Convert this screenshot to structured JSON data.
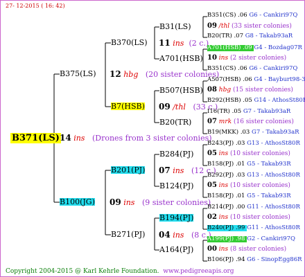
{
  "header": {
    "date": "27- 12-2015 ( 16: 42)"
  },
  "footer": {
    "copyright": "Copyright 2004-2015 @ Karl Kehrle Foundation.",
    "site": "www.pedigreeapis.org"
  },
  "root": {
    "label": "B371(LS)",
    "num": "14",
    "mark": "ins",
    "note": "(Drones from 3 sister colonies)"
  },
  "g1": [
    {
      "label": "B375(LS)",
      "num": "12",
      "mark": "hbg",
      "note": "(20 sister colonies)"
    },
    {
      "label": "B100(JG)",
      "num": "09",
      "mark": "ins",
      "note": "(9 sister colonies)"
    }
  ],
  "g2": [
    {
      "label": "B370(LS)",
      "num": "11",
      "mark": "ins",
      "note": "(2 c.)"
    },
    {
      "label": "B7(HSB)",
      "num": "09",
      "mark": "/thl",
      "note": "(33 c.)"
    },
    {
      "label": "B201(PJ)",
      "num": "07",
      "mark": "ins",
      "note": "(12 c.)"
    },
    {
      "label": "B271(PJ)",
      "num": "04",
      "mark": "ins",
      "note": "(8 c.)"
    }
  ],
  "g3": [
    {
      "label": "B31(LS)",
      "num": "09",
      "mark": "/thl",
      "note": "(33 sister colonies)"
    },
    {
      "label": "A701(HSB)",
      "num": "10",
      "mark": "ins",
      "note": "(2 sister colonies)"
    },
    {
      "label": "B507(HSB)",
      "num": "08",
      "mark": "hbg",
      "note": "(15 sister colonies)"
    },
    {
      "label": "B20(TR)",
      "num": "07",
      "mark": "mrk",
      "note": "(16 sister colonies)"
    },
    {
      "label": "B284(PJ)",
      "num": "05",
      "mark": "ins",
      "note": "(10 sister colonies)"
    },
    {
      "label": "B124(PJ)",
      "num": "05",
      "mark": "ins",
      "note": "(10 sister colonies)"
    },
    {
      "label": "B194(PJ)",
      "num": "02",
      "mark": "ins",
      "note": "(10 sister colonies)"
    },
    {
      "label": "A164(PJ)",
      "num": "00",
      "mark": "ins",
      "note": "(8 sister colonies)"
    }
  ],
  "g4": [
    {
      "label": "B351(CS)",
      "val": ".06",
      "g": "G6 - Cankiri97Q"
    },
    {
      "label": "B20(TR)",
      "val": ".07",
      "g": "G8 - Takab93aR"
    },
    {
      "label": "A701(HSB)",
      "val": ".09",
      "g": "G4 - Bozdag07R"
    },
    {
      "label": "B351(CS)",
      "val": ".06",
      "g": "G6 - Cankiri97Q"
    },
    {
      "label": "A507(HSB)",
      "val": ".06",
      "g": "G4 - Bayburt98-3"
    },
    {
      "label": "B292(HSB)",
      "val": ".05",
      "g": "G14 - AthosSt80R"
    },
    {
      "label": "I16(TR)",
      "val": ".05",
      "g": "G7 - Takab93aR"
    },
    {
      "label": "B19(MKK)",
      "val": ".03",
      "g": "G7 - Takab93aR"
    },
    {
      "label": "B243(PJ)",
      "val": ".03",
      "g": "G13 - AthosSt80R"
    },
    {
      "label": "B158(PJ)",
      "val": ".01",
      "g": "G5 - Takab93R"
    },
    {
      "label": "B292(PJ)",
      "val": ".03",
      "g": "G13 - AthosSt80R"
    },
    {
      "label": "B158(PJ)",
      "val": ".01",
      "g": "G5 - Takab93R"
    },
    {
      "label": "B214(PJ)",
      "val": ".00",
      "g": "G11 - AthosSt80R"
    },
    {
      "label": "B240(PJ)",
      "val": ".99",
      "g": "G11 - AthosSt80R"
    },
    {
      "label": "A199(PJ)",
      "val": ".98",
      "g": "G2 - Cankiri97Q"
    },
    {
      "label": "B106(PJ)",
      "val": ".94",
      "g": "G6 - SinopEgg86R"
    }
  ]
}
